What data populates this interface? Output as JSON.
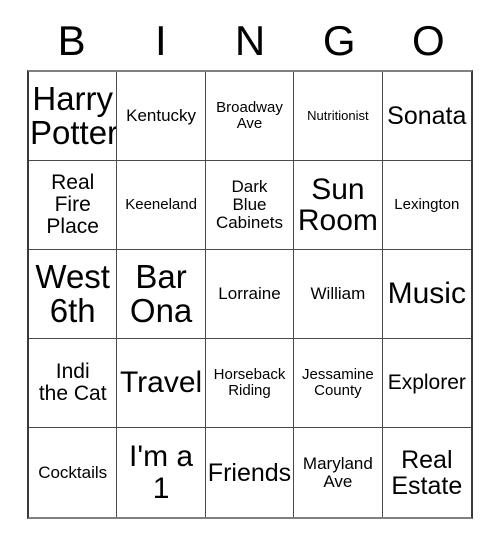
{
  "card": {
    "header_letters": [
      "B",
      "I",
      "N",
      "G",
      "O"
    ],
    "rows": [
      [
        {
          "text": "Harry\nPotter",
          "size": "s-xxxl"
        },
        {
          "text": "Kentucky",
          "size": "s-md"
        },
        {
          "text": "Broadway\nAve",
          "size": "s-sm"
        },
        {
          "text": "Nutritionist",
          "size": "s-xs"
        },
        {
          "text": "Sonata",
          "size": "s-xl"
        }
      ],
      [
        {
          "text": "Real\nFire\nPlace",
          "size": "s-lg"
        },
        {
          "text": "Keeneland",
          "size": "s-sm"
        },
        {
          "text": "Dark\nBlue\nCabinets",
          "size": "s-md"
        },
        {
          "text": "Sun\nRoom",
          "size": "s-xxl"
        },
        {
          "text": "Lexington",
          "size": "s-sm"
        }
      ],
      [
        {
          "text": "West\n6th",
          "size": "s-xxxl"
        },
        {
          "text": "Bar\nOna",
          "size": "s-xxxl"
        },
        {
          "text": "Lorraine",
          "size": "s-md"
        },
        {
          "text": "William",
          "size": "s-md"
        },
        {
          "text": "Music",
          "size": "s-xxl"
        }
      ],
      [
        {
          "text": "Indi\nthe Cat",
          "size": "s-lg"
        },
        {
          "text": "Travel",
          "size": "s-xxl"
        },
        {
          "text": "Horseback\nRiding",
          "size": "s-sm"
        },
        {
          "text": "Jessamine\nCounty",
          "size": "s-sm"
        },
        {
          "text": "Explorer",
          "size": "s-lg"
        }
      ],
      [
        {
          "text": "Cocktails",
          "size": "s-md"
        },
        {
          "text": "I'm a\n1",
          "size": "s-xxl"
        },
        {
          "text": "Friends",
          "size": "s-xl"
        },
        {
          "text": "Maryland\nAve",
          "size": "s-md"
        },
        {
          "text": "Real\nEstate",
          "size": "s-xl"
        }
      ]
    ]
  }
}
